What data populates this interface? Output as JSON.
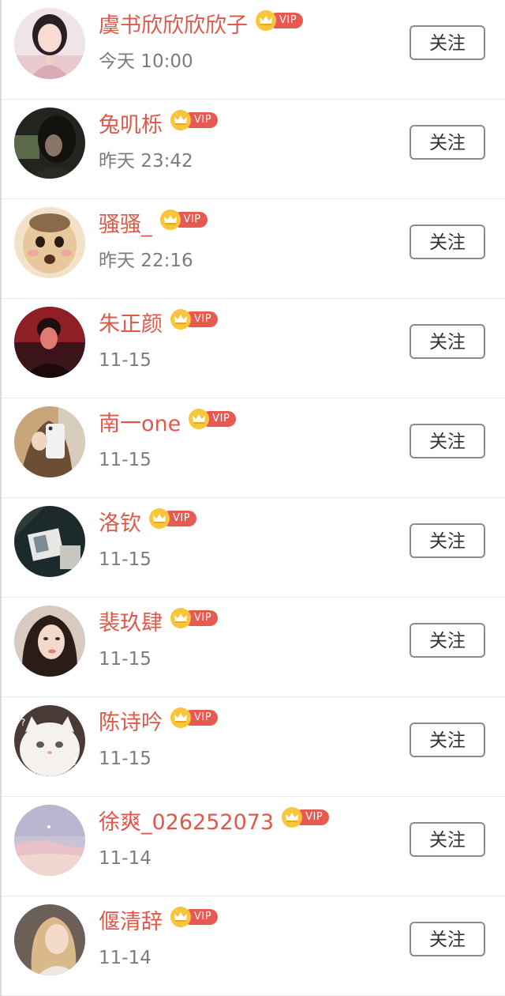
{
  "follow_button_label": "关注",
  "vip_label": "VIP",
  "users": [
    {
      "name": "虞书欣欣欣欣子",
      "time": "今天 10:00",
      "avatar": "girl-heart-hands"
    },
    {
      "name": "兔叽栎",
      "time": "昨天 23:42",
      "avatar": "dark-portrait"
    },
    {
      "name": "骚骚_",
      "time": "昨天 22:16",
      "avatar": "cartoon-face"
    },
    {
      "name": "朱正颜",
      "time": "11-15",
      "avatar": "red-portrait"
    },
    {
      "name": "南一one",
      "time": "11-15",
      "avatar": "phone-selfie"
    },
    {
      "name": "洛钦",
      "time": "11-15",
      "avatar": "dark-photo"
    },
    {
      "name": "裴玖肆",
      "time": "11-15",
      "avatar": "girl-portrait"
    },
    {
      "name": "陈诗吟",
      "time": "11-15",
      "avatar": "white-cat"
    },
    {
      "name": "徐爽_026252073",
      "time": "11-14",
      "avatar": "pastel-sky"
    },
    {
      "name": "偃清辞",
      "time": "11-14",
      "avatar": "blonde-girl"
    }
  ],
  "colors": {
    "name": "#e0584a",
    "vip_badge": "#e65a52",
    "crown": "#f8c63a",
    "time": "#7c7c7c",
    "button_border": "#8a8a8a"
  }
}
